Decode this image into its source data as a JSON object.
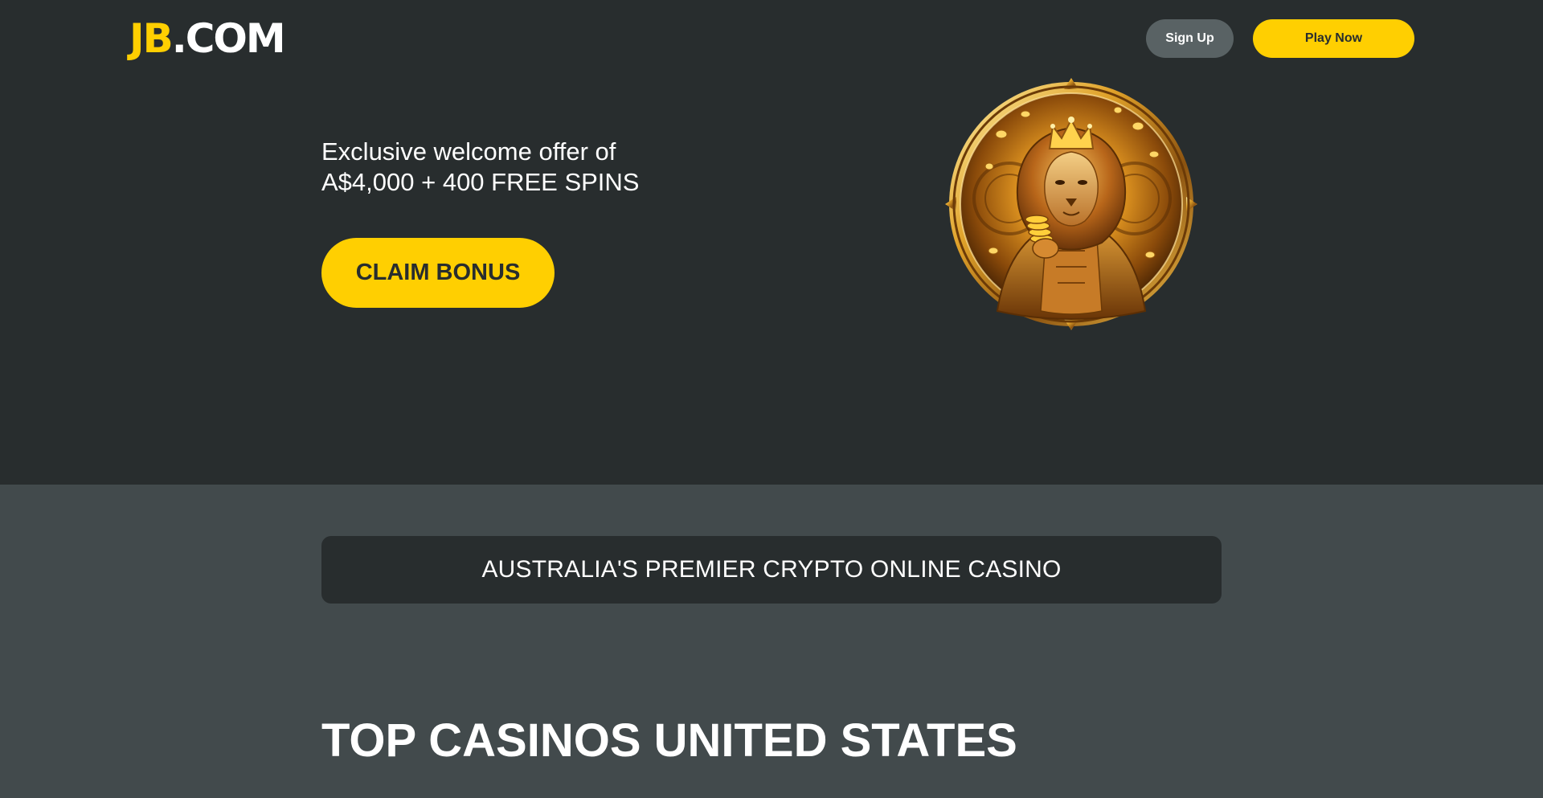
{
  "header": {
    "logo": {
      "primary": "JB",
      "secondary": ".COM"
    },
    "signup_label": "Sign Up",
    "play_label": "Play Now"
  },
  "hero": {
    "offer_line1": "Exclusive welcome offer of",
    "offer_line2": "A$4,000 + 400 FREE SPINS",
    "claim_label": "CLAIM BONUS",
    "image_icon": "lion-king-medallion-icon"
  },
  "banner": {
    "tagline": "AUSTRALIA'S PREMIER CRYPTO ONLINE CASINO"
  },
  "main": {
    "section_title": "TOP CASINOS UNITED STATES"
  },
  "colors": {
    "accent": "#ffcf01",
    "hero_bg": "#282d2e",
    "page_bg": "#424a4c",
    "secondary_button": "#596264"
  }
}
